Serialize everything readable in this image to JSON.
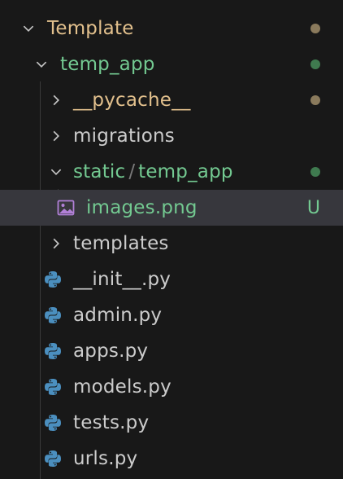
{
  "colors": {
    "background": "#181818",
    "selected_row": "#37373d",
    "modified": "#e2c08d",
    "untracked": "#73c991",
    "dot_modified": "#8a7a5c",
    "dot_untracked": "#3f7a4f",
    "python_icon": "#4b8fbf",
    "image_icon": "#b180d7"
  },
  "tree": {
    "root_folder": {
      "label": "Template",
      "expanded": true,
      "icon": "chevron-down-icon",
      "status": "modified-dot"
    },
    "app_folder": {
      "label": "temp_app",
      "expanded": true,
      "icon": "chevron-down-icon",
      "status": "untracked-dot"
    },
    "pycache_folder": {
      "label": "__pycache__",
      "expanded": false,
      "icon": "chevron-right-icon",
      "status": "modified-dot"
    },
    "migrations_folder": {
      "label": "migrations",
      "expanded": false,
      "icon": "chevron-right-icon"
    },
    "static_folder": {
      "label_part1": "static",
      "separator": "/",
      "label_part2": "temp_app",
      "expanded": true,
      "icon": "chevron-down-icon",
      "status": "untracked-dot"
    },
    "image_file": {
      "label": "images.png",
      "icon": "image-file-icon",
      "badge": "U",
      "selected": true
    },
    "templates_folder": {
      "label": "templates",
      "expanded": false,
      "icon": "chevron-right-icon"
    },
    "files": [
      {
        "label": "__init__.py",
        "icon": "python-icon"
      },
      {
        "label": "admin.py",
        "icon": "python-icon"
      },
      {
        "label": "apps.py",
        "icon": "python-icon"
      },
      {
        "label": "models.py",
        "icon": "python-icon"
      },
      {
        "label": "tests.py",
        "icon": "python-icon"
      },
      {
        "label": "urls.py",
        "icon": "python-icon"
      }
    ]
  }
}
